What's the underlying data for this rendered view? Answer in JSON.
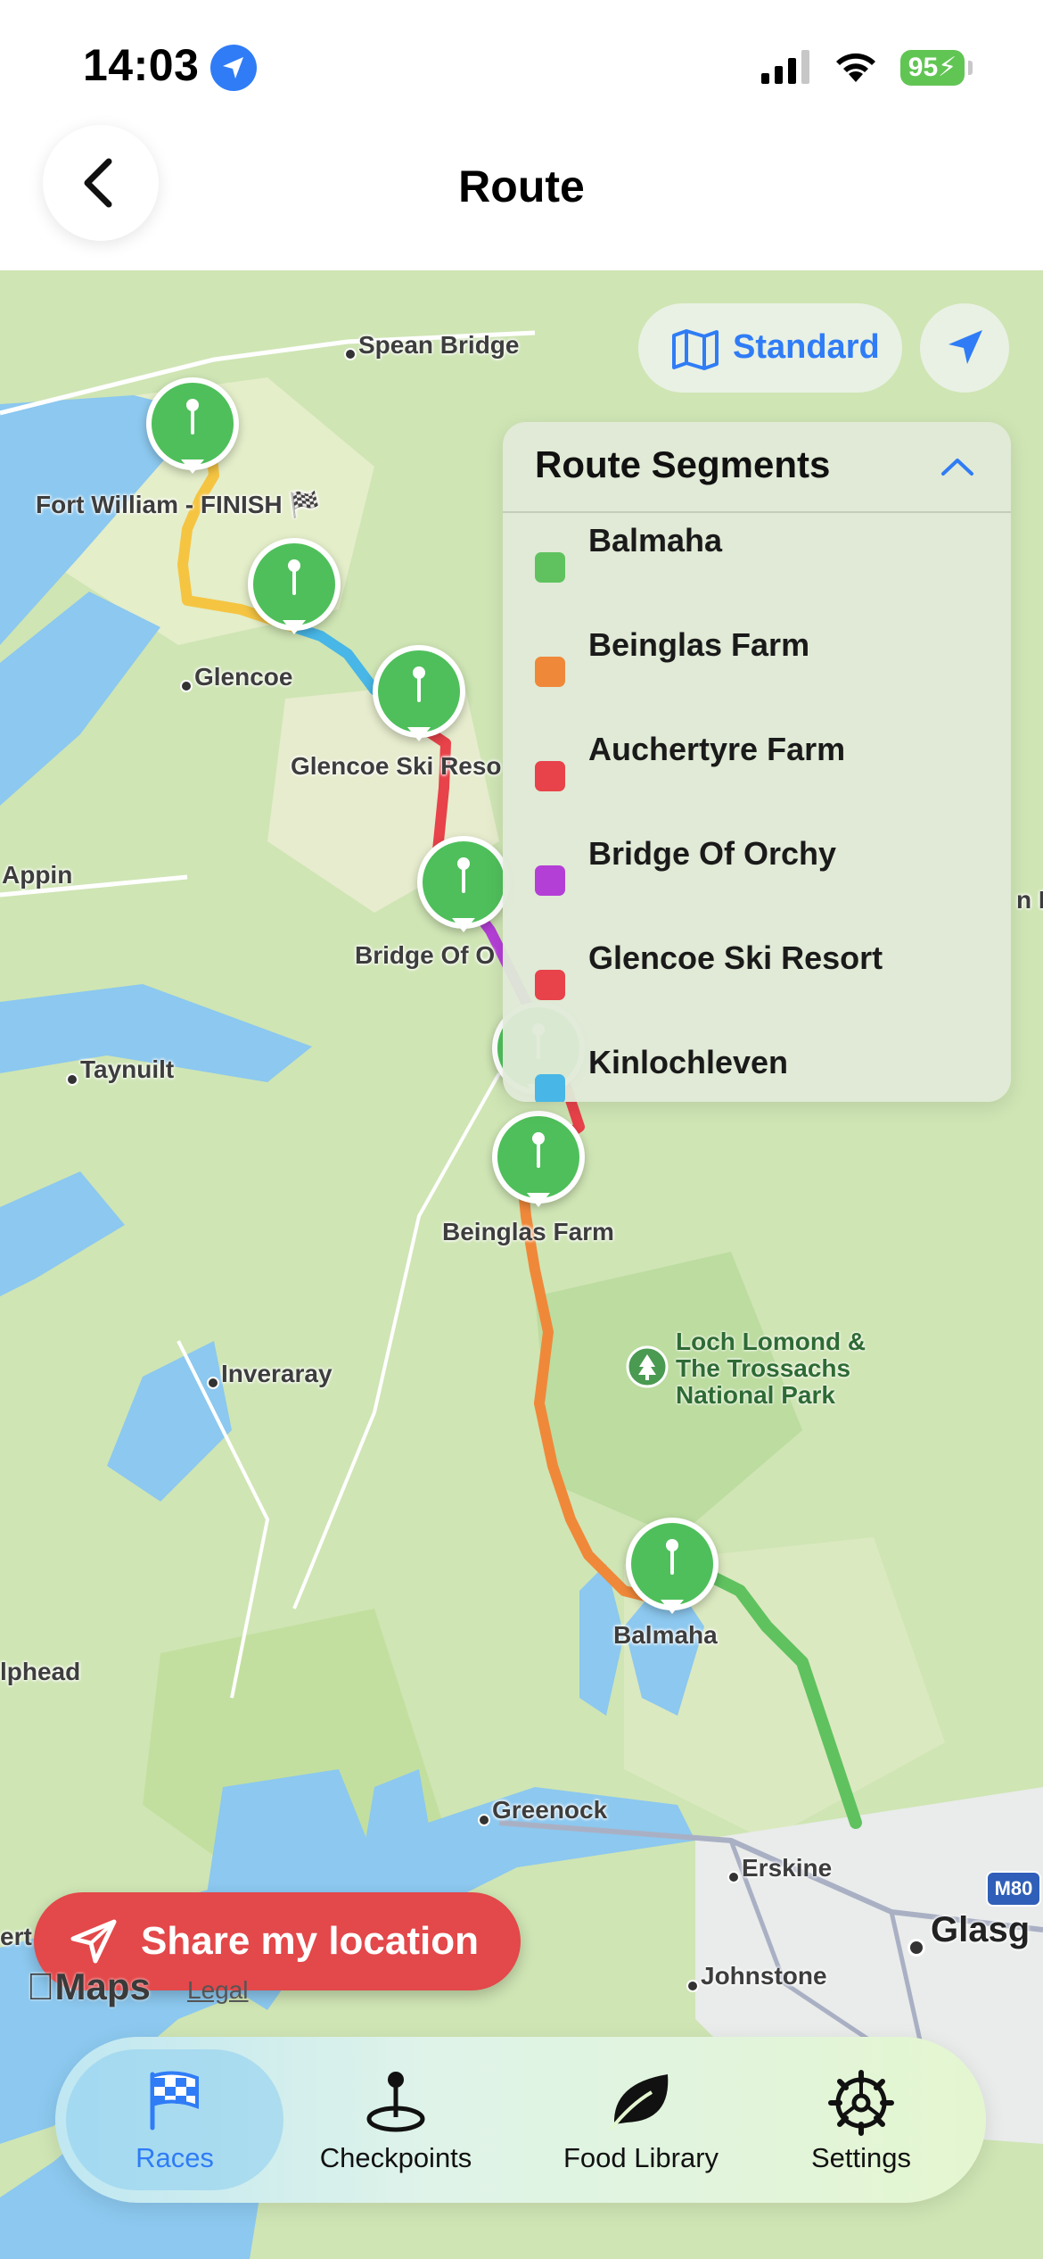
{
  "status_bar": {
    "time": "14:03",
    "battery": "95"
  },
  "header": {
    "title": "Route"
  },
  "map": {
    "style_label": "Standard",
    "places": {
      "spean_bridge": "Spean Bridge",
      "fort_william": "Fort William  - FINISH 🏁",
      "glencoe": "Glencoe",
      "glencoe_ski": "Glencoe Ski Reso",
      "appin": "Appin",
      "bridge_of_orchy": "Bridge Of O",
      "taynuilt": "Taynuilt",
      "beinglas": "Beinglas Farm",
      "inveraray": "Inveraray",
      "loch_lomond": "Loch Lomond &\nThe Trossachs\nNational Park",
      "balmaha": "Balmaha",
      "lphead": "lphead",
      "greenock": "Greenock",
      "erskine": "Erskine",
      "glasgow": "Glasg",
      "johnstone": "Johnstone",
      "ert": "ert",
      "m80": "M80",
      "nl": "n L"
    },
    "maps_logo": "Maps",
    "legal": "Legal"
  },
  "segments": {
    "title": "Route Segments",
    "items": [
      {
        "label": "Balmaha",
        "color": "#5fc25f"
      },
      {
        "label": "Beinglas Farm",
        "color": "#f0883a"
      },
      {
        "label": "Auchertyre Farm",
        "color": "#e8424a"
      },
      {
        "label": "Bridge Of Orchy",
        "color": "#b43fd6"
      },
      {
        "label": "Glencoe Ski Resort",
        "color": "#e8424a"
      },
      {
        "label": "Kinlochleven",
        "color": "#48b6e6"
      }
    ]
  },
  "share": {
    "label": "Share my location"
  },
  "tabs": [
    {
      "label": "Races"
    },
    {
      "label": "Checkpoints"
    },
    {
      "label": "Food Library"
    },
    {
      "label": "Settings"
    }
  ]
}
